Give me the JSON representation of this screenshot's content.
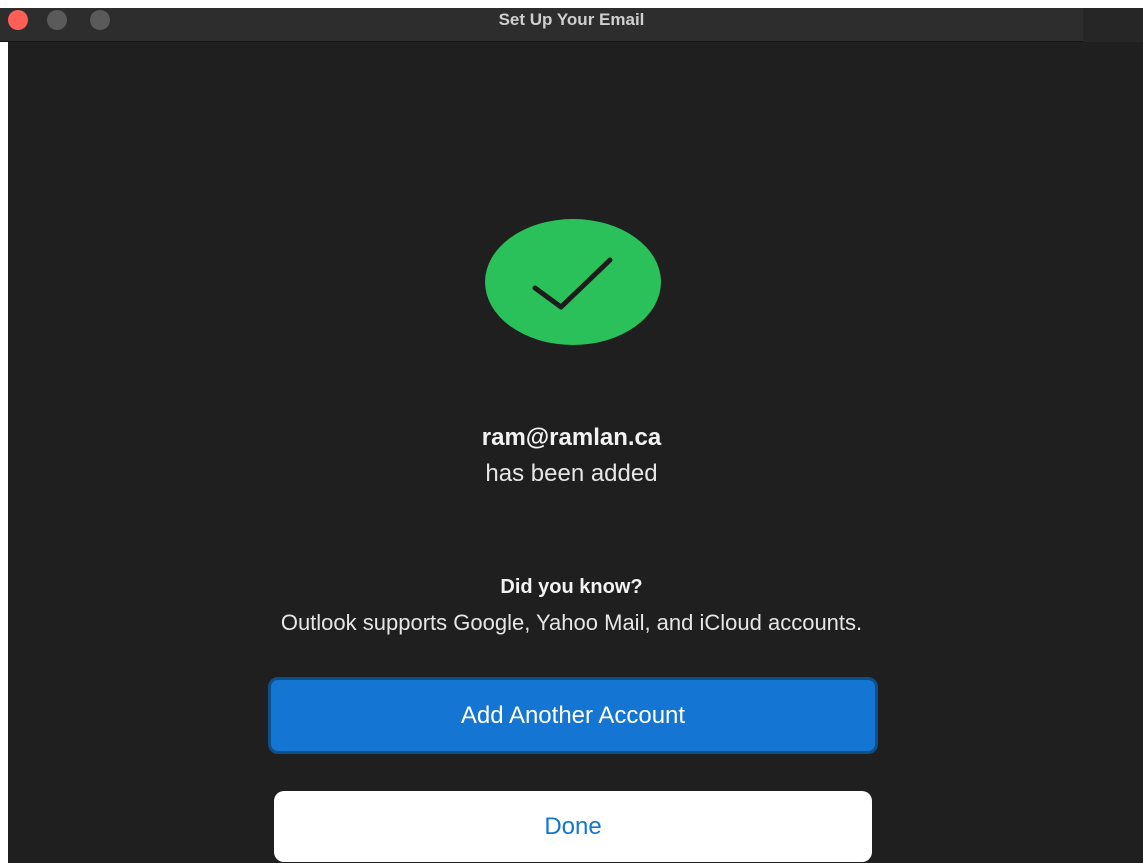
{
  "window": {
    "title": "Set Up Your Email"
  },
  "traffic_lights": {
    "close_color": "#ff5f57",
    "inactive_color": "#5a5a5a"
  },
  "success": {
    "icon": "checkmark-icon",
    "color": "#2ac05a",
    "email": "ram@ramlan.ca",
    "message": "has been added"
  },
  "tip": {
    "title": "Did you know?",
    "text": "Outlook supports Google, Yahoo Mail, and iCloud accounts."
  },
  "buttons": {
    "add_account_label": "Add Another Account",
    "done_label": "Done"
  },
  "colors": {
    "background": "#1f1f1f",
    "accent": "#1476d2"
  }
}
